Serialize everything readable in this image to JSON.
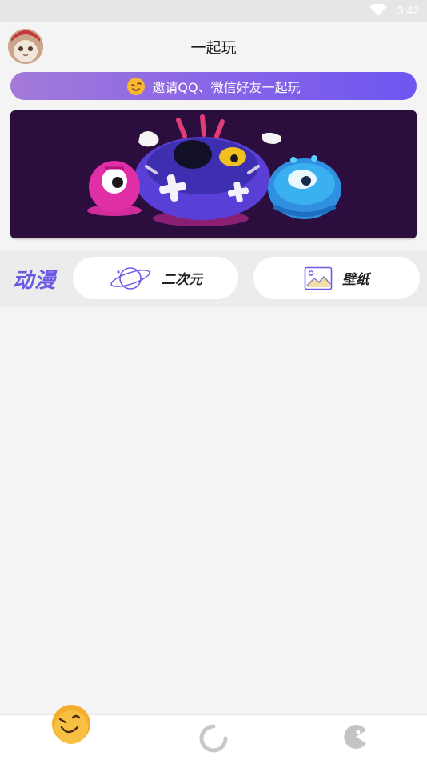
{
  "status_bar": {
    "time": "3:42"
  },
  "header": {
    "title": "一起玩"
  },
  "invite": {
    "text": "邀请QQ、微信好友一起玩"
  },
  "category": {
    "title": "动漫",
    "items": [
      {
        "label": "二次元",
        "icon": "planet-icon"
      },
      {
        "label": "壁纸",
        "icon": "image-icon"
      }
    ]
  },
  "bottom_nav": [
    "home-emoji-icon",
    "loading-refresh-icon",
    "pacman-icon"
  ],
  "colors": {
    "accent": "#6b5ae6",
    "invite_start": "#a47ad8",
    "invite_end": "#6f56f0"
  }
}
